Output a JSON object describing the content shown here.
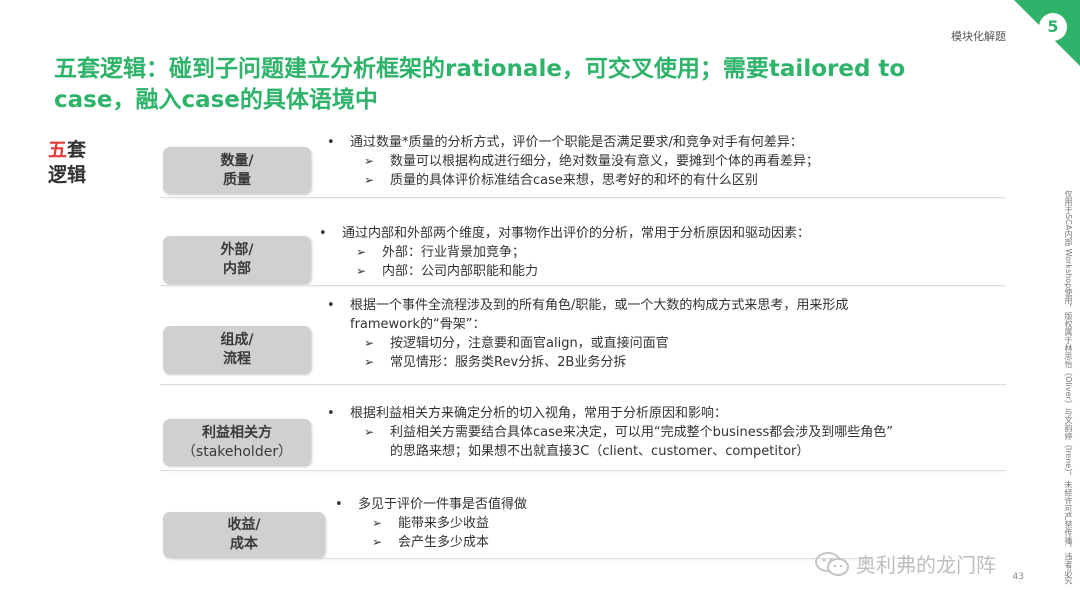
{
  "header": {
    "section_label": "模块化解题",
    "page_badge": "5",
    "title_line1": "五套逻辑：碰到子问题建立分析框架的rationale，可交叉使用；需要tailored to",
    "title_line2": "case，融入case的具体语境中"
  },
  "side_title": {
    "red_char": "五",
    "rest": "套",
    "line2": "逻辑"
  },
  "sections": [
    {
      "label": [
        "数量/",
        "质量"
      ],
      "bullet": "通过数量*质量的分析方式，评价一个职能是否满足要求/和竞争对手有何差异：",
      "subs": [
        "数量可以根据构成进行细分，绝对数量没有意义，要摊到个体的再看差异；",
        "质量的具体评价标准结合case来想，思考好的和坏的有什么区别"
      ]
    },
    {
      "label": [
        "外部/",
        "内部"
      ],
      "bullet": "通过内部和外部两个维度，对事物作出评价的分析，常用于分析原因和驱动因素：",
      "subs": [
        "外部：行业背景加竞争；",
        "内部：公司内部职能和能力"
      ]
    },
    {
      "label": [
        "组成/",
        "流程"
      ],
      "bullet": "根据一个事件全流程涉及到的所有角色/职能，或一个大数的构成方式来思考，用来形成",
      "bullet_cont": "framework的“骨架”：",
      "subs": [
        "按逻辑切分，注意要和面官align，或直接问面官",
        "常见情形：服务类Rev分拆、2B业务分拆"
      ]
    },
    {
      "label": [
        "利益相关方",
        "（stakeholder）"
      ],
      "bullet": "根据利益相关方来确定分析的切入视角，常用于分析原因和影响：",
      "subs": [
        "利益相关方需要结合具体case来决定，可以用“完成整个business都会涉及到哪些角色”"
      ],
      "sub_cont": "的思路来想；如果想不出就直接3C（client、customer、competitor）"
    },
    {
      "label": [
        "收益/",
        "成本"
      ],
      "bullet": "多见于评价一件事是否值得做",
      "subs": [
        "能带来多少收益",
        "会产生多少成本"
      ]
    }
  ],
  "footer": {
    "watermark": "奥利弗的龙门阵",
    "slide_number": "43",
    "vertical_note": "仅用于SCA内部 Workshop使用，版权属于林思怡（Oliver）与文韵婷（Irene），未经许可严禁传播，违者必究"
  },
  "colors": {
    "accent": "#2fb36b",
    "red": "#e53935",
    "label_bg": "#d0d0d0"
  },
  "icons": {
    "arrow": "arrow-bullet-icon",
    "dot": "bullet-dot-icon",
    "wechat": "wechat-icon"
  }
}
